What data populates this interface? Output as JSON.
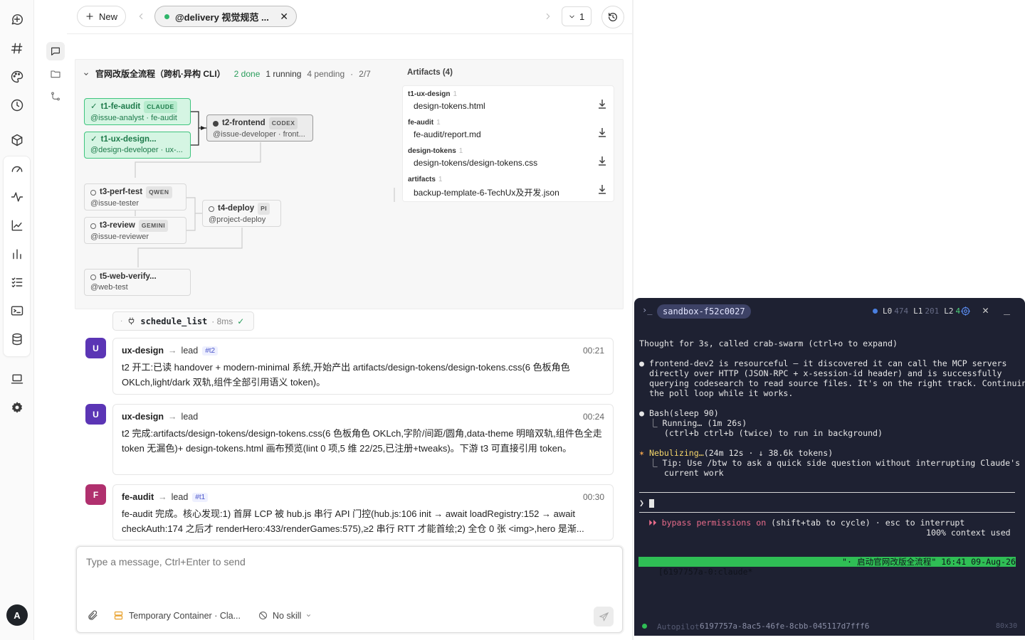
{
  "topbar": {
    "new_label": "New",
    "chat_tab": "@delivery 视觉规范 ...",
    "version_label": "1"
  },
  "workflow": {
    "title": "官网改版全流程（跨机·异构 CLI）",
    "done": "2 done",
    "running": "1 running",
    "pending": "4 pending",
    "sep": "·",
    "progress": "2/7",
    "nodes": [
      {
        "name": "t1-fe-audit",
        "engine": "CLAUDE",
        "sub": "@issue-analyst · fe-audit",
        "status": "done"
      },
      {
        "name": "t1-ux-design...",
        "engine": "",
        "sub": "@design-developer · ux-...",
        "status": "done"
      },
      {
        "name": "t2-frontend",
        "engine": "CODEX",
        "sub": "@issue-developer · front...",
        "status": "running"
      },
      {
        "name": "t3-perf-test",
        "engine": "QWEN",
        "sub": "@issue-tester",
        "status": "pending"
      },
      {
        "name": "t3-review",
        "engine": "GEMINI",
        "sub": "@issue-reviewer",
        "status": "pending"
      },
      {
        "name": "t4-deploy",
        "engine": "PI",
        "sub": "@project-deploy",
        "status": "pending"
      },
      {
        "name": "t5-web-verify...",
        "engine": "",
        "sub": "@web-test",
        "status": "pending"
      }
    ]
  },
  "artifacts": {
    "title": "Artifacts (4)",
    "items": [
      {
        "group": "t1-ux-design",
        "count": "1",
        "file": "design-tokens.html"
      },
      {
        "group": "fe-audit",
        "count": "1",
        "file": "fe-audit/report.md"
      },
      {
        "group": "design-tokens",
        "count": "1",
        "file": "design-tokens/design-tokens.css"
      },
      {
        "group": "artifacts",
        "count": "1",
        "file": "backup-template-6-TechUx及开发.json"
      }
    ]
  },
  "toolcall": {
    "name": "schedule_list",
    "duration": "· 8ms"
  },
  "messages": [
    {
      "avatar": "U",
      "color": "#5b35b5",
      "from": "ux-design",
      "to": "lead",
      "ref": "#t2",
      "time": "00:21",
      "body": "t2 开工:已读 handover + modern-minimal 系统,开始产出 artifacts/design-tokens/design-tokens.css(6 色板角色 OKLch,light/dark 双轨,组件全部引用语义 token)。"
    },
    {
      "avatar": "U",
      "color": "#5b35b5",
      "from": "ux-design",
      "to": "lead",
      "ref": "",
      "time": "00:24",
      "body": "t2 完成:artifacts/design-tokens/design-tokens.css(6 色板角色 OKLch,字阶/间距/圆角,data-theme 明暗双轨,组件色全走 token 无漏色)+ design-tokens.html 画布预览(lint 0 项,5 维 22/25,已注册+tweaks)。下游 t3 可直接引用 token。"
    },
    {
      "avatar": "F",
      "color": "#b0306e",
      "from": "fe-audit",
      "to": "lead",
      "ref": "#t1",
      "time": "00:30",
      "body": "fe-audit 完成。核心发现:1) 首屏 LCP 被 hub.js 串行 API 门控(hub.js:106 init → await loadRegistry:152 → await checkAuth:174 之后才 renderHero:433/renderGames:575),≥2 串行 RTT 才能首绘;2) 全仓 0 张 <img>,hero 是渐..."
    }
  ],
  "composer": {
    "placeholder": "Type a message, Ctrl+Enter to send",
    "container": "Temporary Container · Cla...",
    "skill": "No skill"
  },
  "terminal": {
    "session": "sandbox-f52c0027",
    "levels": [
      {
        "label": "L0",
        "value": "474"
      },
      {
        "label": "L1",
        "value": "201"
      },
      {
        "label": "L2",
        "value": "4"
      }
    ],
    "lines": [
      "Thought for 3s, called crab-swarm (ctrl+o to expand)",
      "● frontend-dev2 is resourceful — it discovered it can call the MCP servers",
      "  directly over HTTP (JSON-RPC + x-session-id header) and is successfully",
      "  querying codesearch to read source files. It's on the right track. Continuing",
      "  the poll loop while it works.",
      "● Bash(sleep 90)",
      "  ⎿ Running… (1m 26s)",
      "     (ctrl+b ctrl+b (twice) to run in background)",
      "  (24m 12s · ↓ 38.6k tokens)",
      "  ⎿ Tip: Use /btw to ask a quick side question without interrupting Claude's",
      "     current work"
    ],
    "spinner_word": "Nebulizing…",
    "spinner_mark": "✶",
    "prompt": "❯",
    "bypass_mark": "⏵⏵",
    "bypass_text": "bypass permissions on",
    "bypass_rest": " (shift+tab to cycle) · esc to interrupt",
    "context": "100% context used",
    "status_left": "[6197757a-0:claude*",
    "status_right": "\"· 启动官网改版全流程\" 16:41 09-Aug-26",
    "footer_mode": "Autopilot",
    "footer_id": "6197757a-8ac5-46fe-8cbb-045117d7fff6",
    "footer_size": "80x30"
  },
  "user": {
    "initial": "A"
  }
}
